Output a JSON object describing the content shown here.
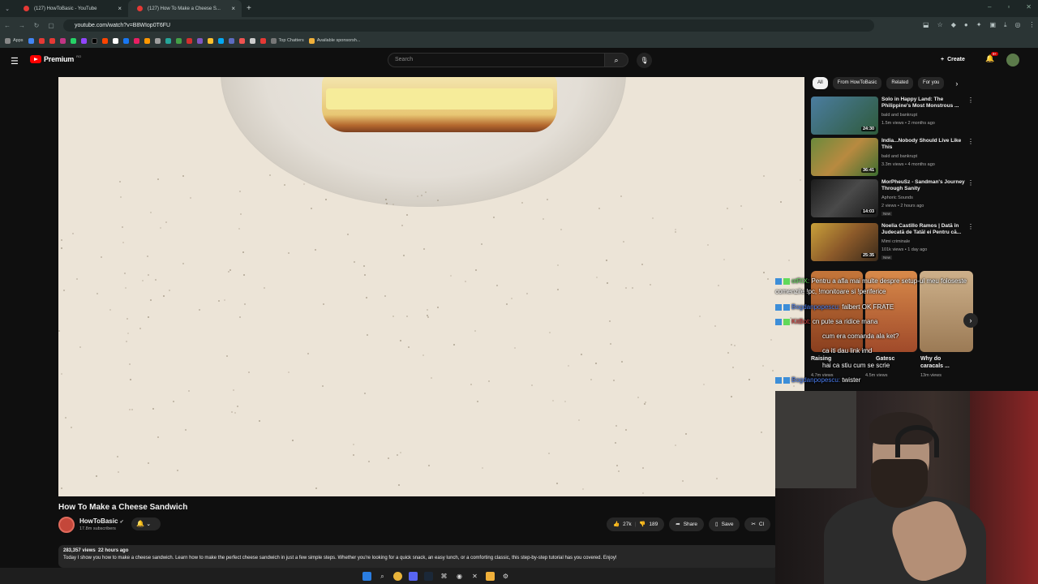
{
  "browser": {
    "tabs": [
      {
        "label": "(127) HowToBasic - YouTube",
        "active": false
      },
      {
        "label": "(127) How To Make a Cheese S...",
        "active": true
      }
    ],
    "url": "youtube.com/watch?v=B8WIop0T6FU",
    "bookmarks": {
      "apps_label": "Apps",
      "top_chatters": "Top Chatters",
      "available": "Available sponsorsh..."
    }
  },
  "header": {
    "logo_text": "Premium",
    "logo_sup": "RO",
    "search_placeholder": "Search",
    "create_label": "Create",
    "notif_count": "9+"
  },
  "video": {
    "title": "How To Make a Cheese Sandwich",
    "channel": "HowToBasic",
    "subscribers": "17.8m subscribers",
    "likes": "27k",
    "dislikes": "189",
    "share_label": "Share",
    "save_label": "Save",
    "clip_label": "Cl",
    "views": "283,357 views",
    "age": "22 hours ago",
    "description": "Today I show you how to make a cheese sandwich. Learn how to make the perfect cheese sandwich in just a few simple steps. Whether you're looking for a quick snack, an easy lunch, or a comforting classic, this step-by-step tutorial has you covered. Enjoy!"
  },
  "sidebar": {
    "chips": [
      "All",
      "From HowToBasic",
      "Related",
      "For you"
    ],
    "recommendations": [
      {
        "title": "Solo in Happy Land: The Philippine's Most Monstrous ...",
        "channel": "bald and bankrupt",
        "views": "1.5m views • 2 months ago",
        "duration": "24:30",
        "new": "",
        "color": "#3a6e8c"
      },
      {
        "title": "India...Nobody Should Live Like This",
        "channel": "bald and bankrupt",
        "views": "3.3m views • 4 months ago",
        "duration": "36:41",
        "new": "",
        "color": "#6b8a3c"
      },
      {
        "title": "MorPheuSz - Sandman's Journey Through Sanity",
        "channel": "Aphoric Sounds",
        "views": "2 views • 2 hours ago",
        "duration": "14:03",
        "new": "New",
        "color": "#2b2b2b"
      },
      {
        "title": "Noelia Castillo Ramos | Dată în Judecată de Tatăl ei Pentru că...",
        "channel": "Mimi criminale",
        "views": "101k views • 1 day ago",
        "duration": "25:35",
        "new": "New",
        "color": "#8c5a2a"
      }
    ],
    "shorts": [
      {
        "title": "Raising",
        "views": "4.7m views",
        "color": "#b8612e"
      },
      {
        "title": "Gatesc",
        "views": "4.5m views",
        "color": "#c26a3a"
      },
      {
        "title": "Why do caracals ...",
        "views": "13m views",
        "color": "#b99a72"
      }
    ]
  },
  "chat": [
    {
      "user": "otRIX:",
      "msg": "Pentru a afla mai multe despre setup-ul meu foloseste"
    },
    {
      "user": "",
      "msg": "comenzile !pc, !monitoare si !periferice"
    },
    {
      "user": "Bogdanpopescu:",
      "msg": "falbert OK FRATE"
    },
    {
      "user": "KitBot:",
      "msg": "cn pute sa ridice mana"
    },
    {
      "user": "",
      "msg": "cum era comanda ala ket?"
    },
    {
      "user": "",
      "msg": "ca iti dau link imd"
    },
    {
      "user": "",
      "msg": "hai ca stiu cum se scrie"
    },
    {
      "user": "Bogdanpopescu:",
      "msg": "twister"
    }
  ]
}
